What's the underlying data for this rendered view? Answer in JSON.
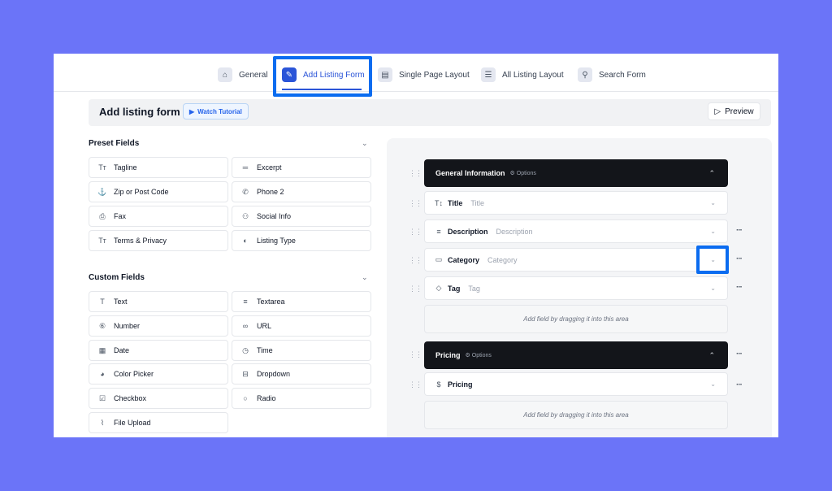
{
  "tabs": [
    {
      "label": "General",
      "icon": "home-icon"
    },
    {
      "label": "Add Listing Form",
      "icon": "form-icon"
    },
    {
      "label": "Single Page Layout",
      "icon": "layout-icon"
    },
    {
      "label": "All Listing Layout",
      "icon": "list-icon"
    },
    {
      "label": "Search Form",
      "icon": "search-icon"
    }
  ],
  "header": {
    "title": "Add listing form",
    "tutorial_label": "Watch Tutorial",
    "preview_label": "Preview"
  },
  "preset": {
    "title": "Preset Fields",
    "fields": [
      {
        "label": "Tagline",
        "icon": "text-icon"
      },
      {
        "label": "Excerpt",
        "icon": "short-text-icon"
      },
      {
        "label": "Zip or Post Code",
        "icon": "anchor-icon"
      },
      {
        "label": "Phone 2",
        "icon": "phone-icon"
      },
      {
        "label": "Fax",
        "icon": "printer-icon"
      },
      {
        "label": "Social Info",
        "icon": "users-icon"
      },
      {
        "label": "Terms & Privacy",
        "icon": "text-icon"
      },
      {
        "label": "Listing Type",
        "icon": "toggle-icon"
      }
    ]
  },
  "custom": {
    "title": "Custom Fields",
    "fields": [
      {
        "label": "Text",
        "icon": "text-icon"
      },
      {
        "label": "Textarea",
        "icon": "textarea-icon"
      },
      {
        "label": "Number",
        "icon": "number-icon"
      },
      {
        "label": "URL",
        "icon": "link-icon"
      },
      {
        "label": "Date",
        "icon": "calendar-icon"
      },
      {
        "label": "Time",
        "icon": "clock-icon"
      },
      {
        "label": "Color Picker",
        "icon": "palette-icon"
      },
      {
        "label": "Dropdown",
        "icon": "dropdown-icon"
      },
      {
        "label": "Checkbox",
        "icon": "checkbox-icon"
      },
      {
        "label": "Radio",
        "icon": "radio-icon"
      },
      {
        "label": "File Upload",
        "icon": "paperclip-icon"
      }
    ]
  },
  "builder": {
    "options_label": "Options",
    "dropzone_text": "Add field by dragging it into this area",
    "sections": [
      {
        "name": "General Information",
        "fields": [
          {
            "label": "Title",
            "placeholder": "Title",
            "icon": "title-icon"
          },
          {
            "label": "Description",
            "placeholder": "Description",
            "icon": "lines-icon"
          },
          {
            "label": "Category",
            "placeholder": "Category",
            "icon": "folder-icon"
          },
          {
            "label": "Tag",
            "placeholder": "Tag",
            "icon": "tag-icon"
          }
        ]
      },
      {
        "name": "Pricing",
        "fields": [
          {
            "label": "Pricing",
            "placeholder": "",
            "icon": "price-icon"
          }
        ]
      }
    ]
  },
  "colors": {
    "accent": "#2b55d8",
    "highlight": "#0b6cf0",
    "background": "#6b74f8",
    "section_header": "#13151a"
  }
}
